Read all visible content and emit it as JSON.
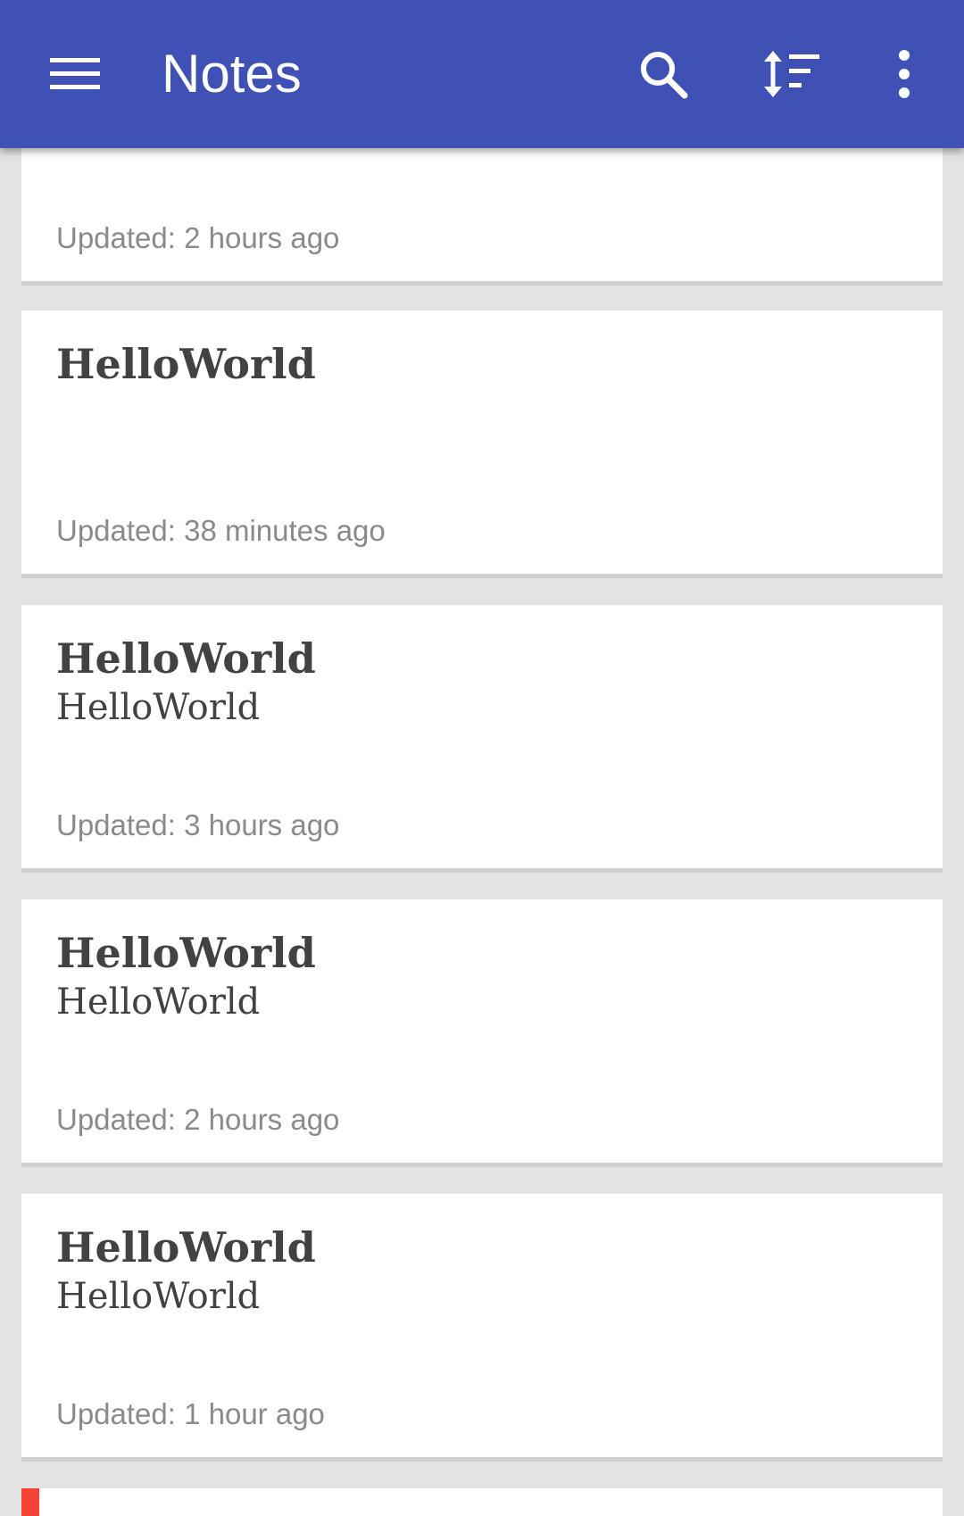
{
  "app_bar": {
    "title": "Notes",
    "background": "#3f51b5",
    "icons": {
      "menu": "menu-icon",
      "search": "search-icon",
      "sort": "sort-icon",
      "overflow": "more-vert-icon"
    }
  },
  "notes": [
    {
      "title": "",
      "body": "",
      "updated": "Updated: 2 hours ago"
    },
    {
      "title": "HelloWorld",
      "body": "",
      "updated": "Updated: 38 minutes ago"
    },
    {
      "title": "HelloWorld",
      "body": "HelloWorld",
      "updated": "Updated: 3 hours ago"
    },
    {
      "title": "HelloWorld",
      "body": "HelloWorld",
      "updated": "Updated: 2 hours ago"
    },
    {
      "title": "HelloWorld",
      "body": "HelloWorld",
      "updated": "Updated: 1 hour ago"
    },
    {
      "title": "",
      "body": "",
      "updated": "",
      "color_tag": "#f44336"
    }
  ]
}
